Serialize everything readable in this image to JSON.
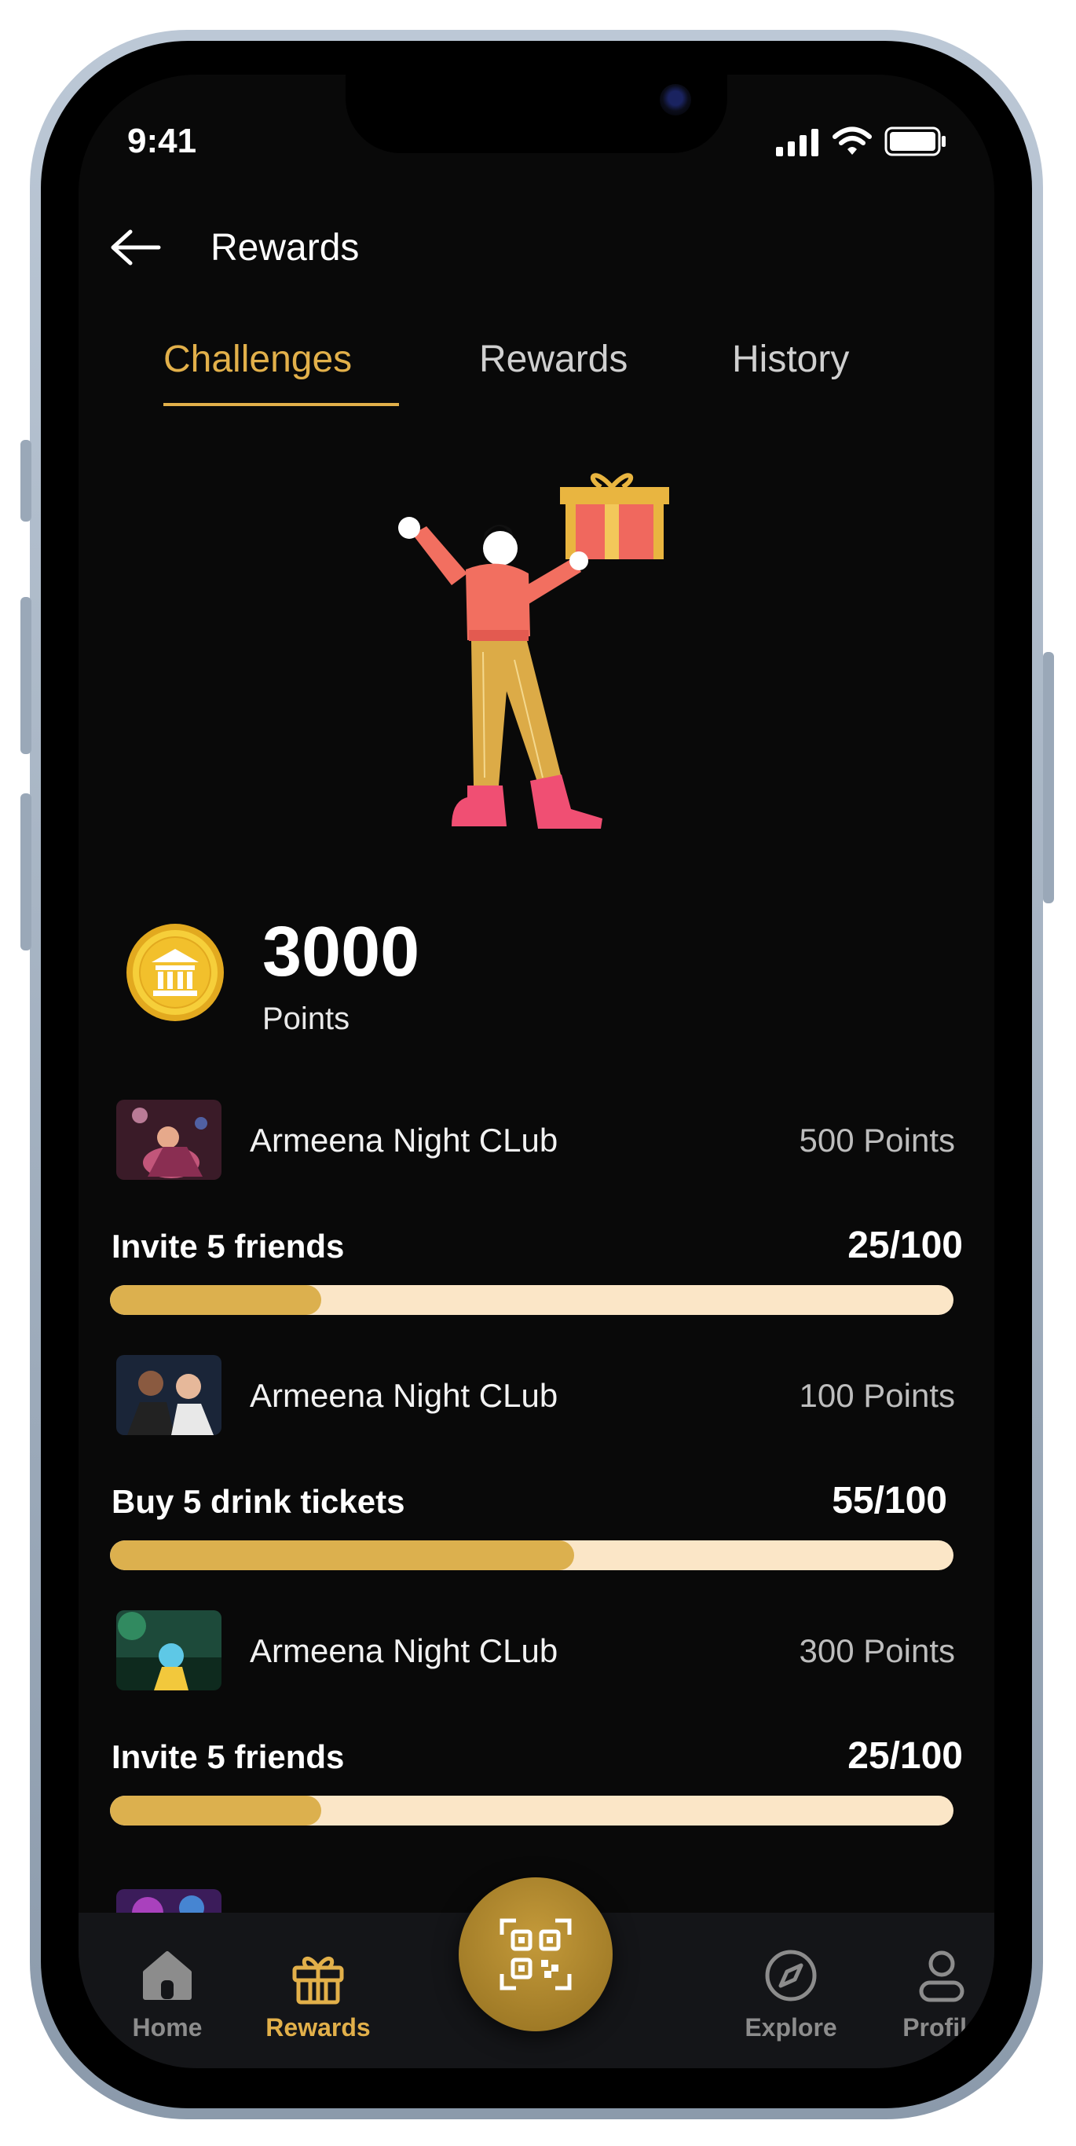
{
  "status_bar": {
    "time": "9:41"
  },
  "header": {
    "title": "Rewards"
  },
  "tabs": [
    {
      "label": "Challenges",
      "active": true
    },
    {
      "label": "Rewards",
      "active": false
    },
    {
      "label": "History",
      "active": false
    }
  ],
  "points": {
    "value": "3000",
    "label": "Points"
  },
  "challenges": [
    {
      "club": "Armeena Night CLub",
      "reward": "500 Points",
      "task": "Invite 5 friends",
      "progress_text": "25/100",
      "progress": 0.25
    },
    {
      "club": "Armeena Night CLub",
      "reward": "100 Points",
      "task": "Buy 5 drink tickets",
      "progress_text": "55/100",
      "progress": 0.55
    },
    {
      "club": "Armeena Night CLub",
      "reward": "300 Points",
      "task": "Invite 5 friends",
      "progress_text": "25/100",
      "progress": 0.25
    }
  ],
  "bottom_nav": {
    "items": [
      {
        "label": "Home",
        "icon": "home-icon",
        "active": false
      },
      {
        "label": "Rewards",
        "icon": "gift-icon",
        "active": true
      },
      {
        "label": "Explore",
        "icon": "compass-icon",
        "active": false
      },
      {
        "label": "Profile",
        "icon": "profile-icon",
        "active": false
      }
    ],
    "center_action": "qr-scan-icon"
  },
  "colors": {
    "accent": "#e2b04a",
    "background": "#090909",
    "bar_track": "#fbe6c7",
    "bar_fill": "#dcb04e"
  }
}
